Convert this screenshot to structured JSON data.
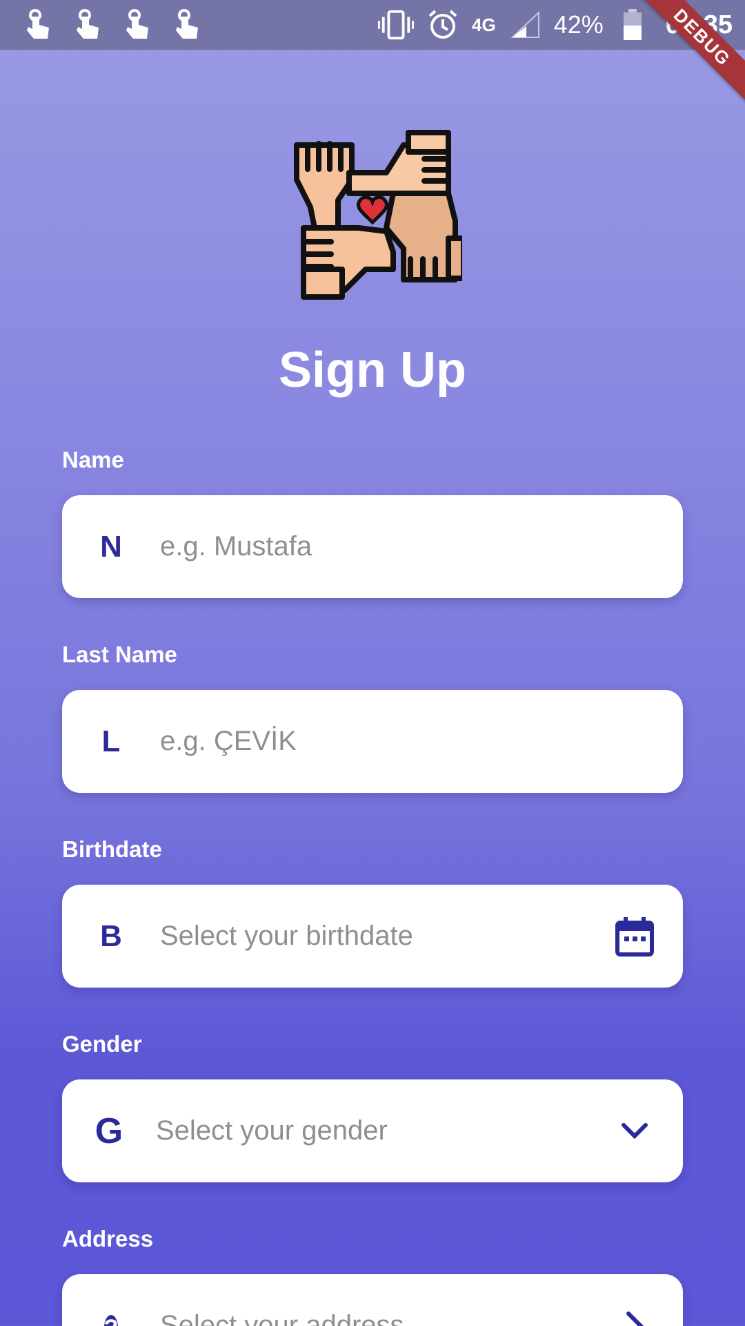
{
  "status_bar": {
    "battery_percent": "42%",
    "time": "02:35",
    "network_type": "4G",
    "left_icons": [
      "touch-app-icon",
      "touch-app-icon",
      "touch-app-icon",
      "touch-app-icon"
    ],
    "right_icons": [
      "vibrate-icon",
      "alarm-icon",
      "signal-icon",
      "battery-icon"
    ]
  },
  "debug_banner": "DEBUG",
  "app": {
    "logo": "hands-heart-icon",
    "title": "Sign Up"
  },
  "form": {
    "name": {
      "label": "Name",
      "prefix": "N",
      "placeholder": "e.g. Mustafa"
    },
    "last_name": {
      "label": "Last Name",
      "prefix": "L",
      "placeholder": "e.g. ÇEVİK"
    },
    "birthdate": {
      "label": "Birthdate",
      "prefix": "B",
      "placeholder": "Select your birthdate",
      "trailing_icon": "calendar-icon"
    },
    "gender": {
      "label": "Gender",
      "prefix": "G",
      "placeholder": "Select your gender",
      "trailing_icon": "chevron-down-icon"
    },
    "address": {
      "label": "Address",
      "prefix_icon": "help-circle-icon",
      "placeholder": "Select your address",
      "trailing_icon": "chevron-right-icon"
    }
  },
  "colors": {
    "accent": "#2b2a9a",
    "status_bar": "#7474a6",
    "debug_ribbon": "#a6343b",
    "placeholder": "#8e8e93"
  }
}
